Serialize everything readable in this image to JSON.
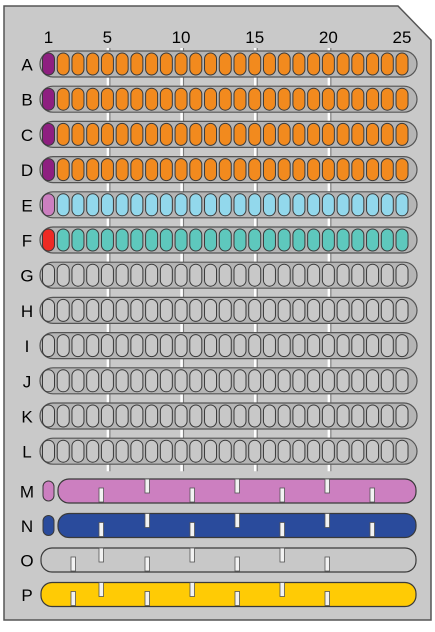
{
  "plate": {
    "column_labels": [
      "1",
      "5",
      "10",
      "15",
      "20",
      "25"
    ],
    "column_label_positions": [
      1,
      5,
      10,
      15,
      20,
      25
    ],
    "well_rows": [
      {
        "label": "A",
        "first_color": "#8e1f80",
        "well_color": "#f28a1e"
      },
      {
        "label": "B",
        "first_color": "#8e1f80",
        "well_color": "#f28a1e"
      },
      {
        "label": "C",
        "first_color": "#8e1f80",
        "well_color": "#f28a1e"
      },
      {
        "label": "D",
        "first_color": "#8e1f80",
        "well_color": "#f28a1e"
      },
      {
        "label": "E",
        "first_color": "#cc7fc0",
        "well_color": "#92d8ec"
      },
      {
        "label": "F",
        "first_color": "#ee2a24",
        "well_color": "#5ec8bd"
      },
      {
        "label": "G",
        "first_color": "#c8c8c8",
        "well_color": "#c8c8c8"
      },
      {
        "label": "H",
        "first_color": "#c8c8c8",
        "well_color": "#c8c8c8"
      },
      {
        "label": "I",
        "first_color": "#c8c8c8",
        "well_color": "#c8c8c8"
      },
      {
        "label": "J",
        "first_color": "#c8c8c8",
        "well_color": "#c8c8c8"
      },
      {
        "label": "K",
        "first_color": "#c8c8c8",
        "well_color": "#c8c8c8"
      },
      {
        "label": "L",
        "first_color": "#c8c8c8",
        "well_color": "#c8c8c8"
      }
    ],
    "channel_rows": [
      {
        "label": "M",
        "cap_color": "#cc7fc0",
        "channel_color": "#cc7fc0"
      },
      {
        "label": "N",
        "cap_color": "#2a4b9c",
        "channel_color": "#2a4b9c"
      },
      {
        "label": "O",
        "cap_color": "",
        "channel_color": "#c8c8c8"
      },
      {
        "label": "P",
        "cap_color": "",
        "channel_color": "#ffcb05"
      }
    ],
    "colors": {
      "plate_fill": "#c9c9c9",
      "outline": "#555555",
      "well_outline": "#3a3a3a",
      "tray_fill": "#b5b5b5"
    }
  }
}
